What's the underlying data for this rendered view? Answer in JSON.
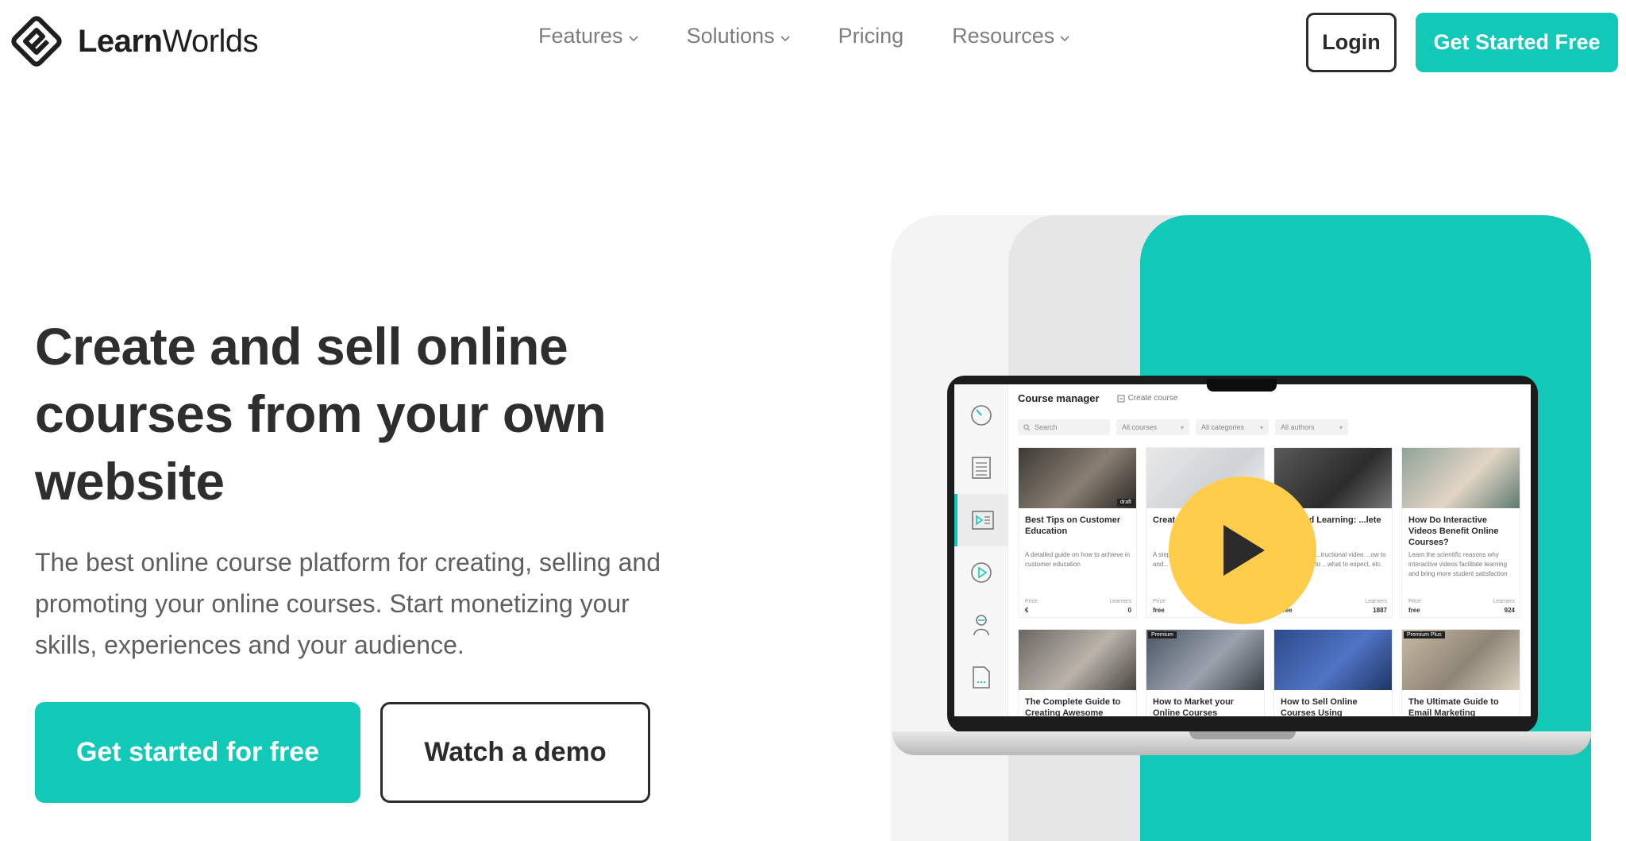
{
  "brand": {
    "name_bold": "Learn",
    "name_light": "Worlds"
  },
  "nav": {
    "items": [
      {
        "label": "Features",
        "has_dropdown": true
      },
      {
        "label": "Solutions",
        "has_dropdown": true
      },
      {
        "label": "Pricing",
        "has_dropdown": false
      },
      {
        "label": "Resources",
        "has_dropdown": true
      }
    ],
    "login_label": "Login",
    "cta_label": "Get Started Free"
  },
  "hero": {
    "title_lines": [
      "Create and sell online",
      "courses from your own",
      "website"
    ],
    "subtitle_lines": [
      "The best online course platform for creating, selling and",
      "promoting your online courses. Start monetizing your",
      "skills, experiences and your audience."
    ],
    "primary_button": "Get started for free",
    "secondary_button": "Watch a demo"
  },
  "app_preview": {
    "header_title": "Course manager",
    "create_course_label": "Create course",
    "filters": {
      "search_placeholder": "Search",
      "courses": "All courses",
      "categories": "All categories",
      "authors": "All authors"
    },
    "cards": [
      {
        "title": "Best Tips on Customer Education",
        "desc": "A detailed guide on how to achieve in customer education",
        "badge": "draft",
        "price_label": "Price",
        "price": "€",
        "learners_label": "Learners",
        "learners": "0"
      },
      {
        "title": "Create... with...",
        "desc": "A step... create... ebooks... video and...",
        "badge": "",
        "price_label": "Price",
        "price": "free",
        "learners_label": "",
        "learners": ""
      },
      {
        "title": "...Based Learning: ...lete Guide",
        "desc": "...course on ...tructional video ...ow to create, how to ...what to expect, etc.",
        "badge": "",
        "price_label": "",
        "price": "free",
        "learners_label": "Learners",
        "learners": "1887"
      },
      {
        "title": "How Do Interactive Videos Benefit Online Courses?",
        "desc": "Learn the scientific reasons why interactive videos facilitate learning and bring more student satisfaction",
        "badge": "",
        "price_label": "Price",
        "price": "free",
        "learners_label": "Learners",
        "learners": "924"
      },
      {
        "title": "The Complete Guide to Creating Awesome",
        "desc": "",
        "badge": "",
        "price_label": "",
        "price": "",
        "learners_label": "",
        "learners": ""
      },
      {
        "title": "How to Market your Online Courses",
        "desc": "",
        "badge": "Premium",
        "price_label": "",
        "price": "",
        "learners_label": "",
        "learners": ""
      },
      {
        "title": "How to Sell Online Courses Using",
        "desc": "",
        "badge": "",
        "price_label": "",
        "price": "",
        "learners_label": "",
        "learners": ""
      },
      {
        "title": "The Ultimate Guide to Email Marketing",
        "desc": "",
        "badge": "Premium Plus",
        "price_label": "",
        "price": "",
        "learners_label": "",
        "learners": ""
      }
    ],
    "sidebar_icons": [
      "dashboard-icon",
      "pages-icon",
      "course-manager-icon",
      "video-icon",
      "users-icon",
      "reports-icon"
    ]
  },
  "colors": {
    "accent": "#12c9b7",
    "play": "#fecd4c",
    "text_dark": "#2e2e2e",
    "text_muted": "#7d7d7d"
  }
}
